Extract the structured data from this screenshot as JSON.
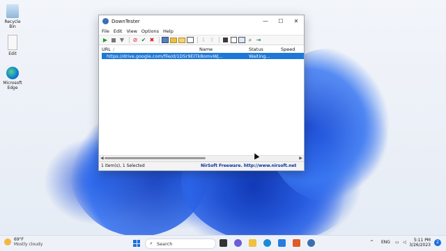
{
  "desktop": {
    "icons": [
      {
        "label": "Recycle Bin",
        "icon": "recycle-bin-icon"
      },
      {
        "label": "Edit",
        "icon": "file-icon"
      },
      {
        "label": "Microsoft Edge",
        "icon": "edge-icon"
      }
    ]
  },
  "window": {
    "title": "DownTester",
    "controls": {
      "minimize": "—",
      "maximize": "☐",
      "close": "✕"
    },
    "menu": [
      "File",
      "Edit",
      "View",
      "Options",
      "Help"
    ],
    "columns": [
      "URL",
      "/",
      "Name",
      "Status",
      "Speed (Bytes"
    ],
    "rows": [
      {
        "url": "https://drive.google.com/file/d/1D5r9EITk8omvWj...",
        "name": "",
        "status": "Waiting...",
        "speed": ""
      }
    ],
    "status_left": "1 item(s), 1 Selected",
    "status_right": "NirSoft Freeware.  http://www.nirsoft.net"
  },
  "taskbar": {
    "weather_temp": "69°F",
    "weather_desc": "Mostly cloudy",
    "search_placeholder": "Search",
    "tray": {
      "chevron": "^",
      "lang": "ENG"
    },
    "time": "5:11 PM",
    "date": "3/26/2023",
    "notification_count": "2"
  },
  "colors": {
    "selection": "#1e78d7",
    "accent": "#1b6fe0"
  }
}
